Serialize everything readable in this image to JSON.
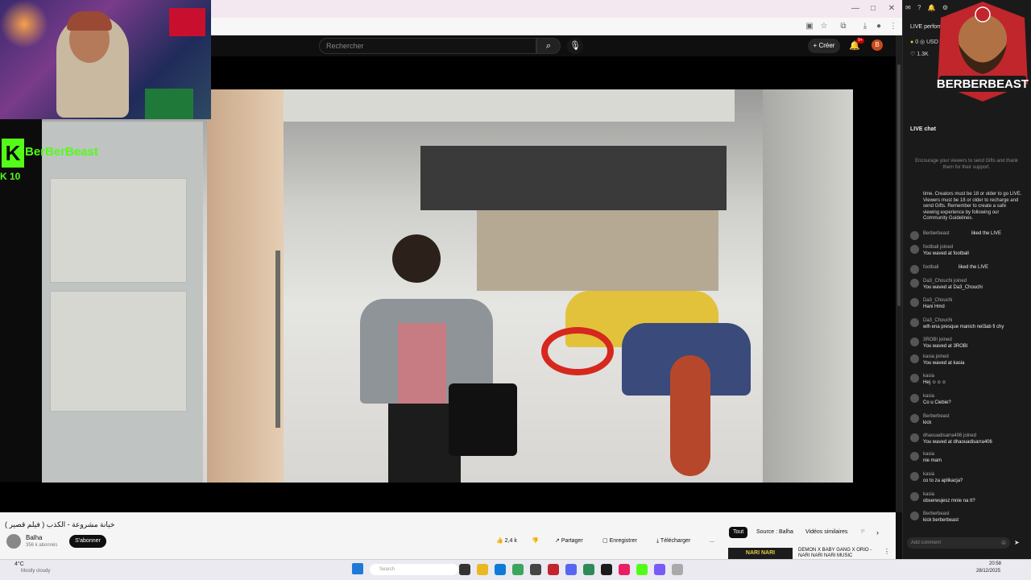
{
  "browser": {
    "window_buttons": [
      "—",
      "□",
      "✕"
    ]
  },
  "youtube": {
    "search_placeholder": "Rechercher",
    "create_label": "Créer",
    "notification_count": "9+",
    "avatar_letter": "B"
  },
  "stream_overlay": {
    "kick_logo": "K",
    "kick_name": "BerBerBeast",
    "viewer_count": "10",
    "brand_badge": "BERBERBEAST"
  },
  "video_info": {
    "title": "خيانة مشروعة - الكذب ( فيلم قصير )",
    "channel_name": "Balha",
    "channel_subs": "356 k abonnés",
    "subscribe_label": "S'abonner",
    "like_count": "2,4 k",
    "share_label": "Partager",
    "save_label": "Enregistrer",
    "download_label": "Télécharger",
    "more_label": "...",
    "chips": [
      "Tout",
      "Source : Balha",
      "Vidéos similaires",
      "P"
    ],
    "recommended_thumb_text": "NARI NARI",
    "recommended_title": "DEMON X BABY GANG X ORIO - NARI NARI NARI MUSIC"
  },
  "live_panel": {
    "title": "LIVE performance",
    "stat_coins": "0",
    "stat_currency": "USD",
    "stat_likes": "1.3K",
    "chat_heading": "LIVE chat",
    "encourage_text": "Encourage your viewers to send Gifts and thank them for their support.",
    "guidelines_text": "time. Creators must be 18 or older to go LIVE. Viewers must be 18 or older to recharge and send Gifts. Remember to create a safe viewing experience by following our Community Guidelines.",
    "messages": [
      {
        "user": "Berberbeast",
        "text": "liked the LIVE"
      },
      {
        "user": "football joined",
        "text": "You waved at football"
      },
      {
        "user": "football",
        "text": "liked the LIVE"
      },
      {
        "user": "Da3_Chouchi joined",
        "text": "You waved at Da3_Chouchi"
      },
      {
        "user": "Da3_Chouchi",
        "text": "Hani Hmd"
      },
      {
        "user": "Da3_Chouchi",
        "text": "wlh ena presque manich nel3ab fi chy"
      },
      {
        "user": "3ROBI joined",
        "text": "You waved at 3ROBI"
      },
      {
        "user": "kasia joined",
        "text": "You waved at kasia"
      },
      {
        "user": "kasia",
        "text": "Hej ☺☺☺"
      },
      {
        "user": "kasia",
        "text": "Co u Ciebie?"
      },
      {
        "user": "Berberbeast",
        "text": "kick"
      },
      {
        "user": "dhaouadisarra406 joined",
        "text": "You waved at dhaouadisarra406"
      },
      {
        "user": "kasia",
        "text": "nie mam"
      },
      {
        "user": "kasia",
        "text": "co to za aplikacja?"
      },
      {
        "user": "kasia",
        "text": "obserwujesz mnie na tt?"
      },
      {
        "user": "Berberbeast",
        "text": "kick berberbeast"
      }
    ],
    "add_comment_placeholder": "Add comment"
  },
  "taskbar": {
    "weather_temp": "4°C",
    "weather_desc": "Mostly cloudy",
    "search_label": "Search",
    "clock_time": "20:58",
    "clock_date": "28/12/2025"
  },
  "colors": {
    "kick_green": "#53fc18",
    "youtube_red": "#cc0000"
  }
}
